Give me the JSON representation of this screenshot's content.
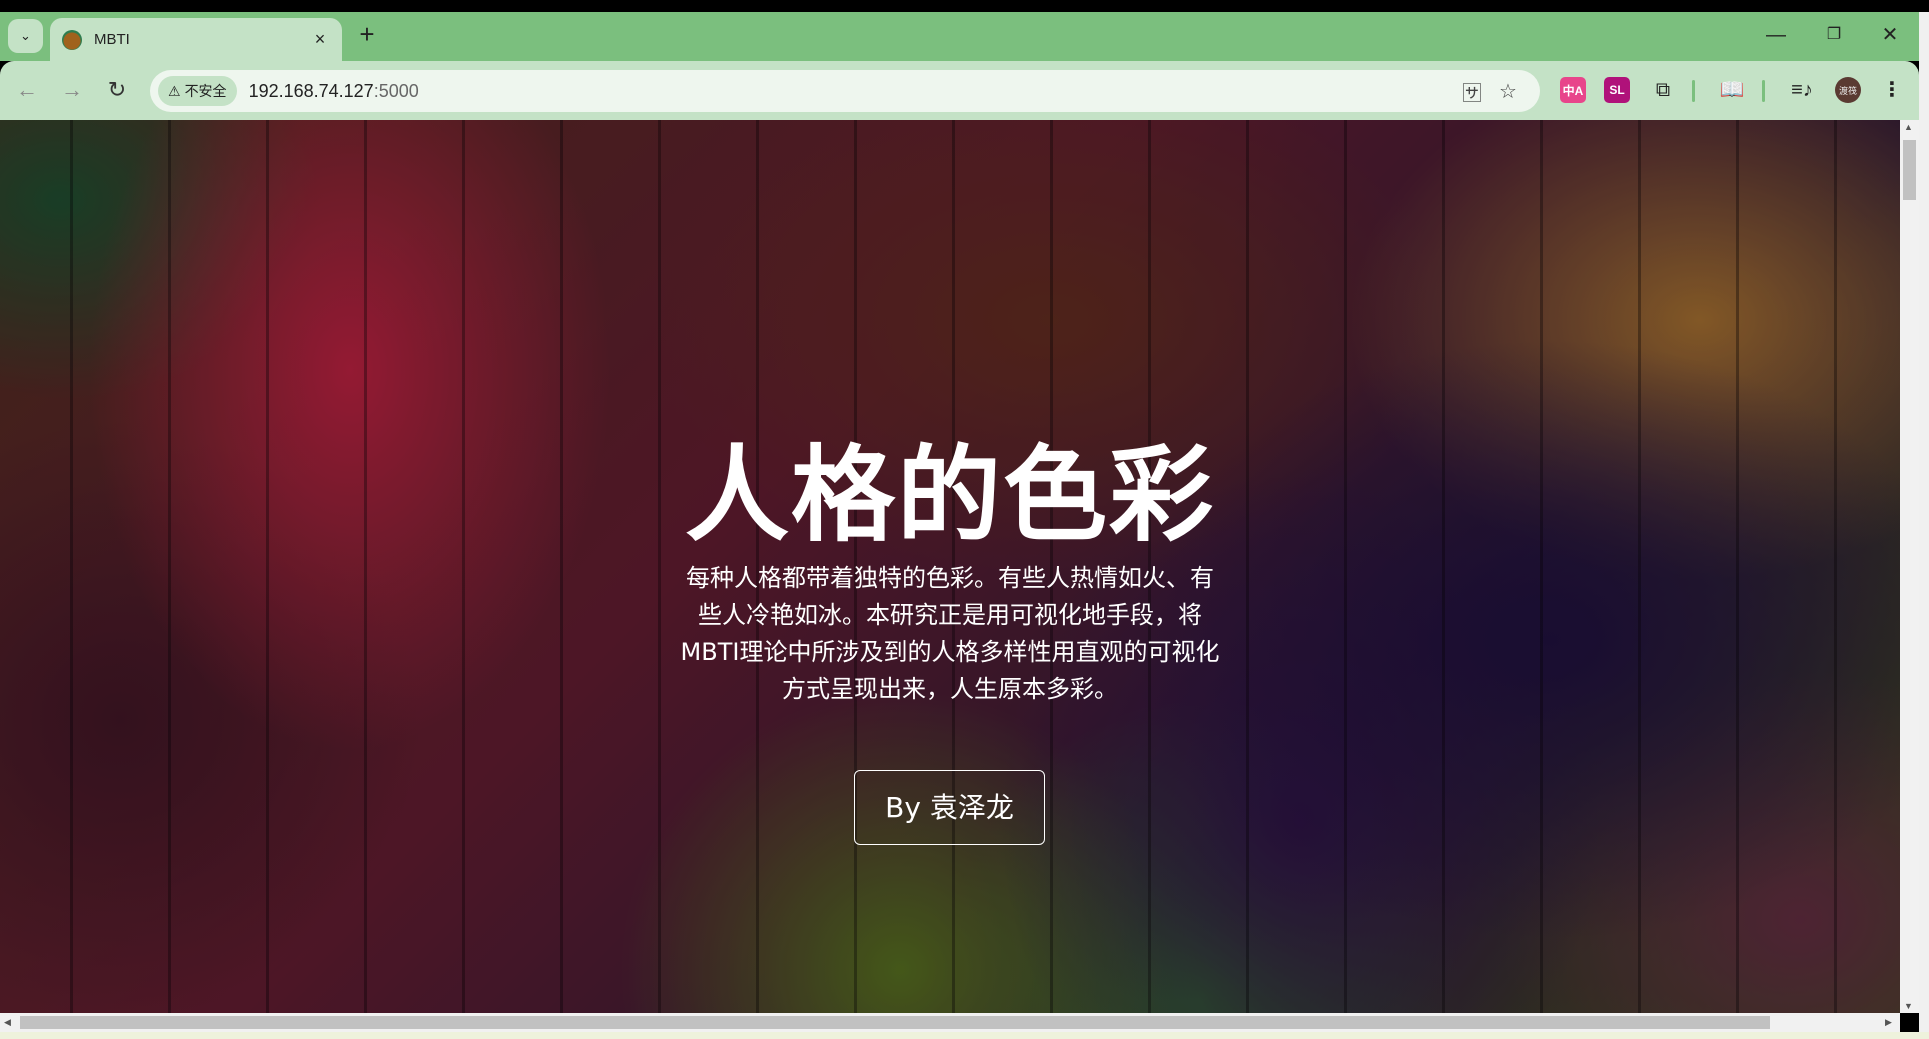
{
  "browser": {
    "tab": {
      "title": "MBTI",
      "close": "×"
    },
    "new_tab": "+",
    "tab_list": "⌄",
    "window_controls": {
      "minimize": "—",
      "restore": "❐",
      "close": "✕"
    },
    "nav": {
      "back": "←",
      "forward": "→",
      "reload": "↻"
    },
    "security_label": "不安全",
    "url_host": "192.168.74.127",
    "url_port": ":5000",
    "extensions": [
      {
        "name": "translate-ext",
        "label": "中A",
        "color": "#e8458b"
      },
      {
        "name": "sl-ext",
        "label": "SL",
        "color": "#b0127a"
      }
    ],
    "profile_label": "渡筏"
  },
  "page": {
    "title": "人格的色彩",
    "description": "每种人格都带着独特的色彩。有些人热情如火、有些人冷艳如冰。本研究正是用可视化地手段，将MBTI理论中所涉及到的人格多样性用直观的可视化方式呈现出来，人生原本多彩。",
    "author_button": "By 袁泽龙"
  }
}
